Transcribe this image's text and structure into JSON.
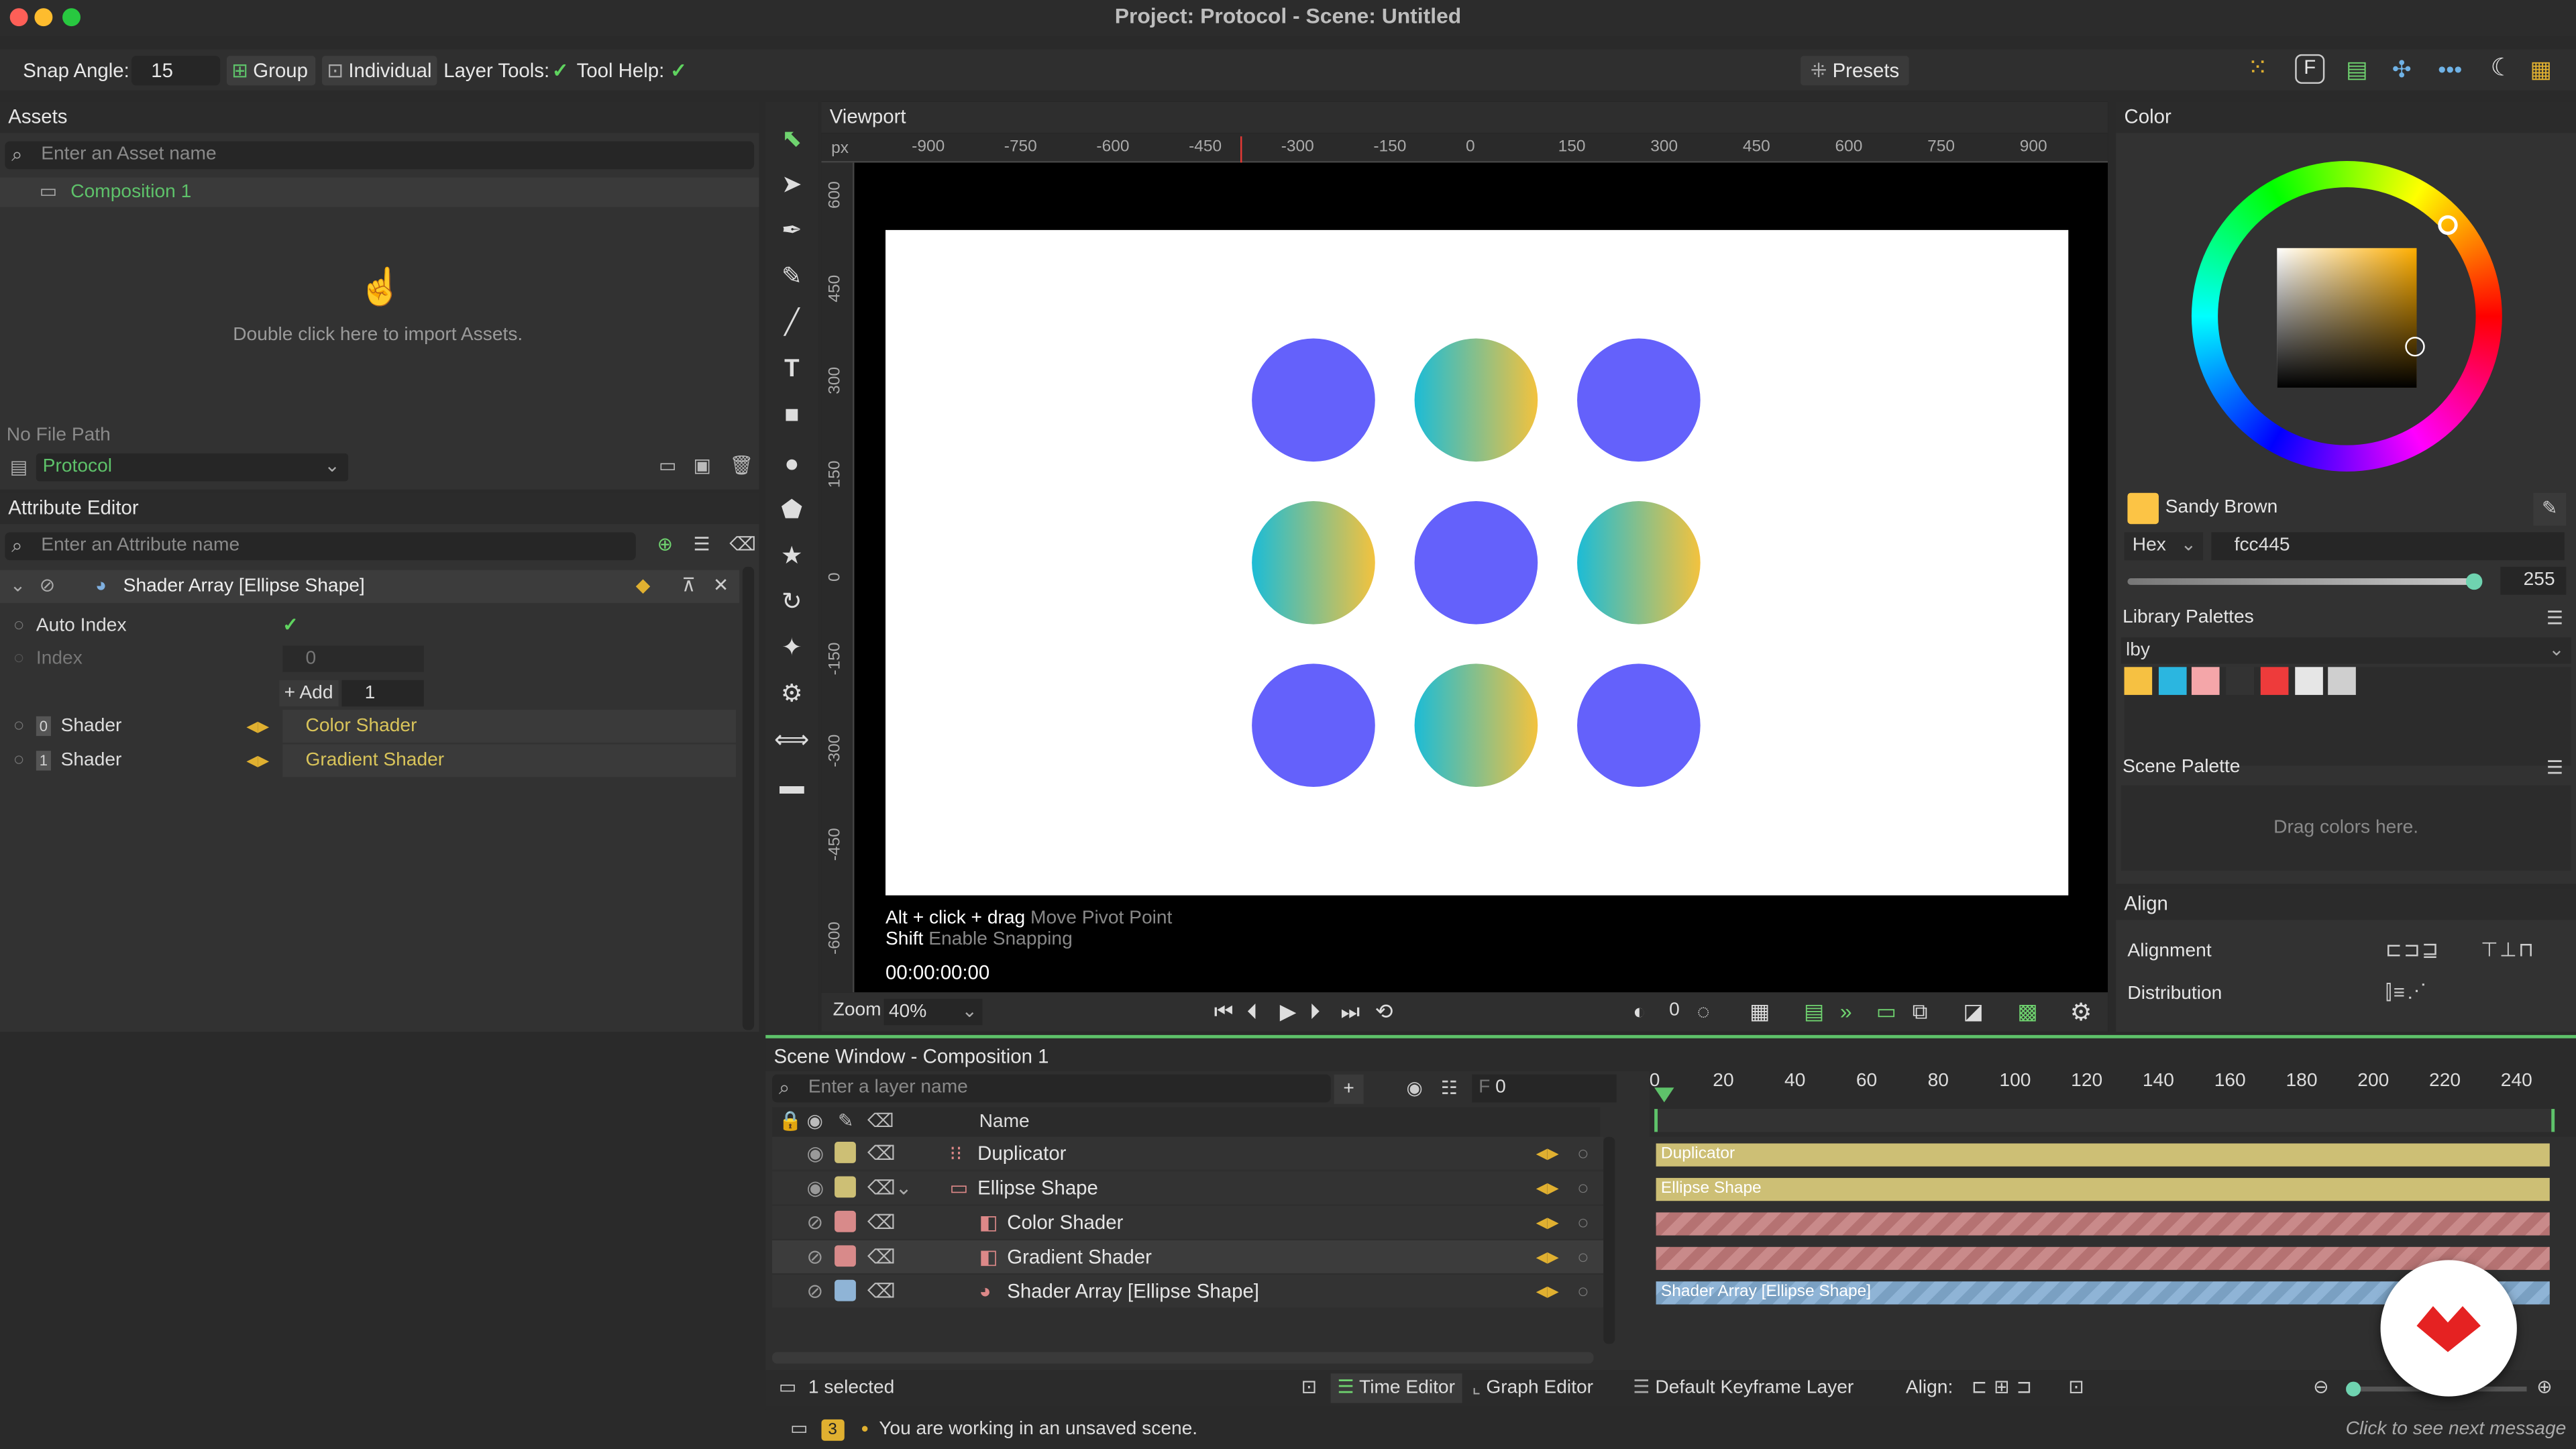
{
  "window": {
    "title": "Project: Protocol - Scene: Untitled"
  },
  "toolbar": {
    "snap_label": "Snap Angle:",
    "snap_value": "15",
    "group": "Group",
    "individual": "Individual",
    "layer_tools": "Layer Tools:",
    "tool_help": "Tool Help:",
    "presets": "Presets"
  },
  "assets": {
    "title": "Assets",
    "search_placeholder": "Enter an Asset name",
    "item": "Composition 1",
    "import_hint": "Double click here to import Assets.",
    "file_path": "No File Path",
    "project": "Protocol"
  },
  "attribute_editor": {
    "title": "Attribute Editor",
    "search_placeholder": "Enter an Attribute name",
    "node": "Shader Array [Ellipse Shape]",
    "auto_index": "Auto Index",
    "index_label": "Index",
    "index_value": "0",
    "add_label": "+ Add",
    "add_value": "1",
    "shaders": [
      {
        "num": "0",
        "label": "Shader",
        "value": "Color Shader"
      },
      {
        "num": "1",
        "label": "Shader",
        "value": "Gradient Shader"
      }
    ]
  },
  "viewport": {
    "title": "Viewport",
    "unit": "px",
    "ruler_x": [
      "-900",
      "-750",
      "-600",
      "-450",
      "-300",
      "-150",
      "0",
      "150",
      "300",
      "450",
      "600",
      "750",
      "900"
    ],
    "ruler_y": [
      "600",
      "450",
      "300",
      "150",
      "0",
      "-150",
      "-300",
      "-450",
      "-600"
    ],
    "hint1_key": "Alt + click + drag",
    "hint1_desc": "Move Pivot Point",
    "hint2_key": "Shift",
    "hint2_desc": "Enable Snapping",
    "timecode": "00:00:00:00",
    "zoom_label": "Zoom",
    "zoom_value": "40%",
    "frame_value": "0",
    "solid_color": "#6461fb",
    "grad_start": "#1cbcd6",
    "grad_end": "#f3c23e",
    "grid": [
      "solid",
      "gradient",
      "solid",
      "gradient",
      "solid",
      "gradient",
      "solid",
      "gradient",
      "solid"
    ]
  },
  "color": {
    "title": "Color",
    "name": "Sandy Brown",
    "mode": "Hex",
    "hex": "fcc445",
    "alpha": "255",
    "swatch": "#fcc445",
    "library_title": "Library Palettes",
    "library_name": "lby",
    "library_colors": [
      "#f6c142",
      "#2bb6e0",
      "#f4a6a9",
      "#333333",
      "#ee3b3b",
      "#e6e6e6",
      "#cfcfcf"
    ],
    "scene_palette_title": "Scene Palette",
    "scene_hint": "Drag colors here."
  },
  "align": {
    "title": "Align",
    "alignment": "Alignment",
    "distribution": "Distribution"
  },
  "scene": {
    "title": "Scene Window - Composition 1",
    "search_placeholder": "Enter a layer name",
    "frame_label": "F",
    "frame_value": "0",
    "name_header": "Name",
    "timeline_ticks": [
      "0",
      "20",
      "40",
      "60",
      "80",
      "100",
      "120",
      "140",
      "160",
      "180",
      "200",
      "220",
      "240"
    ],
    "layers": [
      {
        "name": "Duplicator",
        "color": "#cdbf75"
      },
      {
        "name": "Ellipse Shape",
        "color": "#cdbf75"
      },
      {
        "name": "Color Shader",
        "color": "#d88a8a"
      },
      {
        "name": "Gradient Shader",
        "color": "#d88a8a"
      },
      {
        "name": "Shader Array [Ellipse Shape]",
        "color": "#8fb4d6"
      }
    ],
    "tracks": [
      "Duplicator",
      "Ellipse Shape",
      "",
      "",
      "Shader Array [Ellipse Shape]"
    ],
    "selected": "1 selected",
    "time_editor": "Time Editor",
    "graph_editor": "Graph Editor",
    "keyframe_layer": "Default Keyframe Layer",
    "align_label": "Align:"
  },
  "status": {
    "count": "3",
    "message": "You are working in an unsaved scene.",
    "next": "Click to see next message"
  }
}
